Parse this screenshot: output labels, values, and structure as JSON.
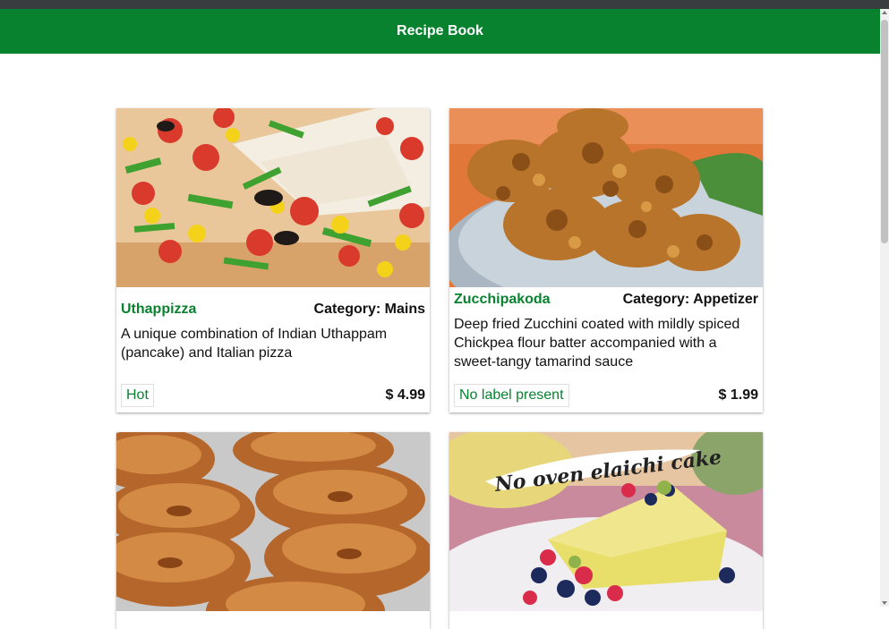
{
  "app": {
    "title": "Recipe Book"
  },
  "cards": [
    {
      "name": "Uthappizza",
      "category": "Category: Mains",
      "description": "A unique combination of Indian Uthappam (pancake) and Italian pizza",
      "label": "Hot",
      "price": "$ 4.99"
    },
    {
      "name": "Zucchipakoda",
      "category": "Category: Appetizer",
      "description": "Deep fried Zucchini coated with mildly spiced Chickpea flour batter accompanied with a sweet-tangy tamarind sauce",
      "label": "No label present",
      "price": "$ 1.99"
    },
    {},
    {
      "image_caption": "No oven elaichi cake"
    }
  ],
  "colors": {
    "accent": "#08822f"
  }
}
